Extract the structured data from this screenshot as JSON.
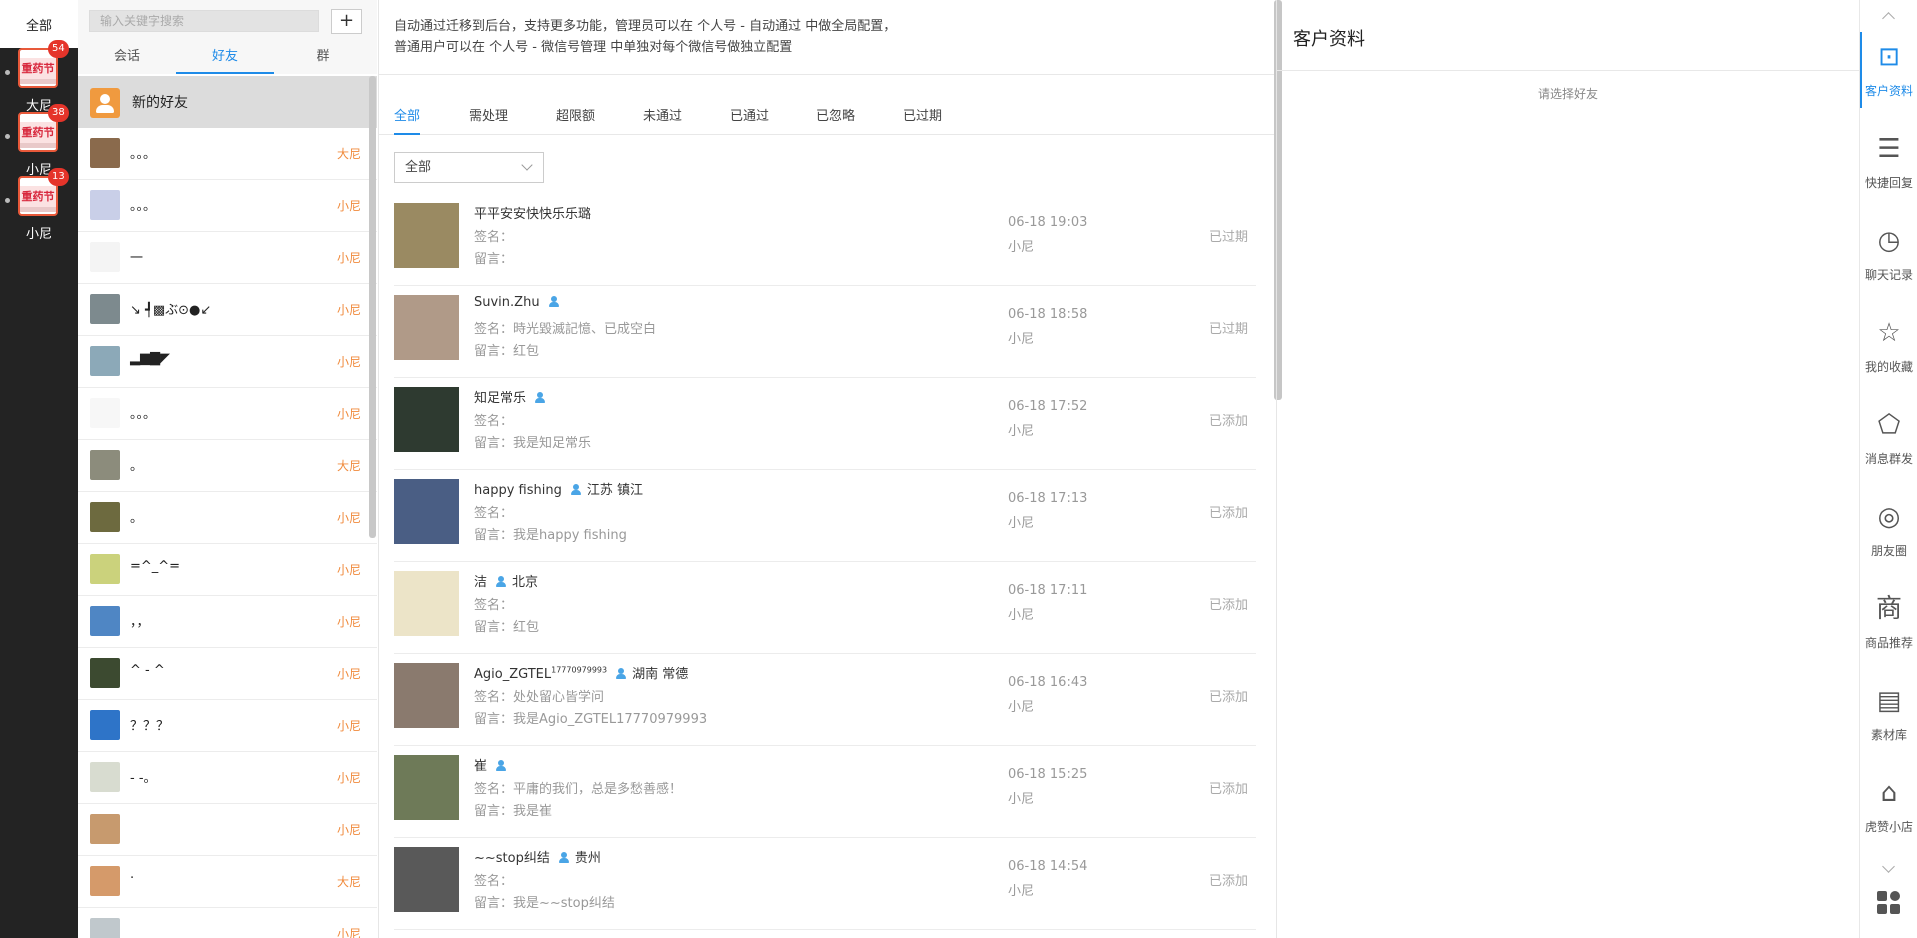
{
  "accounts_header": "全部",
  "accounts": [
    {
      "logo": "重药节",
      "badge": "54",
      "name": "大尼"
    },
    {
      "logo": "重药节",
      "badge": "38",
      "name": "小尼"
    },
    {
      "logo": "重药节",
      "badge": "13",
      "name": "小尼"
    }
  ],
  "search": {
    "placeholder": "输入关键字搜索"
  },
  "add_label": "+",
  "list_tabs": [
    "会话",
    "好友",
    "群"
  ],
  "new_friend": "新的好友",
  "friends": [
    {
      "name": "。。。",
      "tag": "大尼",
      "color": "#8a6a4c"
    },
    {
      "name": "。。。",
      "tag": "小尼",
      "color": "#c9cfe8"
    },
    {
      "name": "一",
      "tag": "小尼",
      "color": "#f4f4f4"
    },
    {
      "name": "↘ ┩▩ぶ⊙●↙",
      "tag": "小尼",
      "color": "#7d8a8e"
    },
    {
      "name": "▂▆▇◤",
      "tag": "小尼",
      "color": "#8ca9b8"
    },
    {
      "name": "。。。",
      "tag": "小尼",
      "color": "#f7f7f7"
    },
    {
      "name": "。",
      "tag": "大尼",
      "color": "#8c8c7c"
    },
    {
      "name": "。",
      "tag": "小尼",
      "color": "#6d6a3f"
    },
    {
      "name": "=^_^=",
      "tag": "小尼",
      "color": "#cbd27c"
    },
    {
      "name": "，，",
      "tag": "小尼",
      "color": "#4f86c4"
    },
    {
      "name": "^ - ^",
      "tag": "小尼",
      "color": "#3c4a30"
    },
    {
      "name": "？？？",
      "tag": "小尼",
      "color": "#2e74c8"
    },
    {
      "name": "- -。",
      "tag": "小尼",
      "color": "#d8dcd0"
    },
    {
      "name": "",
      "tag": "小尼",
      "color": "#c79a6e"
    },
    {
      "name": "·",
      "tag": "大尼",
      "color": "#d59a6a"
    },
    {
      "name": "",
      "tag": "小尼",
      "color": "#c0c8cc"
    }
  ],
  "notice_lines": [
    "自动通过迁移到后台，支持更多功能，管理员可以在 个人号 - 自动通过 中做全局配置，",
    "普通用户可以在 个人号 - 微信号管理 中单独对每个微信号做独立配置"
  ],
  "filter_tabs": [
    "全部",
    "需处理",
    "超限额",
    "未通过",
    "已通过",
    "已忽略",
    "已过期"
  ],
  "filter_select": "全部",
  "requests": [
    {
      "name": "平平安安快快乐乐璐",
      "sup": "",
      "has_icon": false,
      "location": "",
      "sign": "签名：",
      "message": "留言：",
      "time": "06-18 19:03",
      "account": "小尼",
      "status": "已过期",
      "color": "#9a8a62"
    },
    {
      "name": "Suvin.Zhu",
      "sup": "",
      "has_icon": true,
      "location": "",
      "sign": "签名：時光毀滅記憶、已成空白",
      "message": "留言：红包",
      "time": "06-18 18:58",
      "account": "小尼",
      "status": "已过期",
      "color": "#b09a88"
    },
    {
      "name": "知足常乐",
      "sup": "",
      "has_icon": true,
      "location": "",
      "sign": "签名：",
      "message": "留言：我是知足常乐",
      "time": "06-18 17:52",
      "account": "小尼",
      "status": "已添加",
      "color": "#2e3a30"
    },
    {
      "name": "happy fishing",
      "sup": "",
      "has_icon": true,
      "location": "江苏 镇江",
      "sign": "签名：",
      "message": "留言：我是happy fishing",
      "time": "06-18 17:13",
      "account": "小尼",
      "status": "已添加",
      "color": "#4a5e84"
    },
    {
      "name": "洁",
      "sup": "",
      "has_icon": true,
      "location": "北京",
      "sign": "签名：",
      "message": "留言：红包",
      "time": "06-18 17:11",
      "account": "小尼",
      "status": "已添加",
      "color": "#ece4c8"
    },
    {
      "name": "Agio_ZGTEL",
      "sup": "17770979993",
      "has_icon": true,
      "location": "湖南 常德",
      "sign": "签名：处处留心皆学问",
      "message": "留言：我是Agio_ZGTEL17770979993",
      "time": "06-18 16:43",
      "account": "小尼",
      "status": "已添加",
      "color": "#8a7a6e"
    },
    {
      "name": "崔",
      "sup": "",
      "has_icon": true,
      "location": "",
      "sign": "签名：平庸的我们，总是多愁善感！",
      "message": "留言：我是崔",
      "time": "06-18 15:25",
      "account": "小尼",
      "status": "已添加",
      "color": "#6e7a58"
    },
    {
      "name": "~~stop纠结",
      "sup": "",
      "has_icon": true,
      "location": "贵州",
      "sign": "签名：",
      "message": "留言：我是~~stop纠结",
      "time": "06-18 14:54",
      "account": "小尼",
      "status": "已添加",
      "color": "#595959"
    }
  ],
  "customer": {
    "title": "客户资料",
    "hint": "请选择好友"
  },
  "tools": [
    {
      "label": "客户资料",
      "icon": "contact-card-icon",
      "glyph": "⊡",
      "active": true
    },
    {
      "label": "快捷回复",
      "icon": "list-icon",
      "glyph": "☰",
      "active": false
    },
    {
      "label": "聊天记录",
      "icon": "clock-icon",
      "glyph": "◷",
      "active": false
    },
    {
      "label": "我的收藏",
      "icon": "star-icon",
      "glyph": "☆",
      "active": false
    },
    {
      "label": "消息群发",
      "icon": "pentagon-icon",
      "glyph": "⬠",
      "active": false
    },
    {
      "label": "朋友圈",
      "icon": "moments-icon",
      "glyph": "◎",
      "active": false
    },
    {
      "label": "商品推荐",
      "icon": "shop-char-icon",
      "glyph": "商",
      "active": false
    },
    {
      "label": "素材库",
      "icon": "material-icon",
      "glyph": "▤",
      "active": false
    },
    {
      "label": "虎赞小店",
      "icon": "store-icon",
      "glyph": "⌂",
      "active": false
    }
  ]
}
